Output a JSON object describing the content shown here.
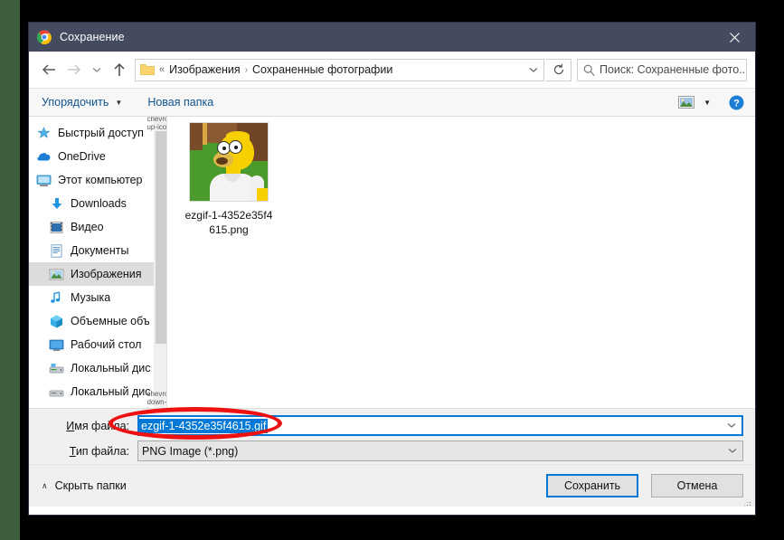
{
  "window": {
    "title": "Сохранение",
    "app_icon": "chrome-logo-icon",
    "close_label": "✕",
    "titlebar_color": "#454b5e"
  },
  "nav": {
    "back_icon": "arrow-left-icon",
    "forward_icon": "arrow-right-icon",
    "recent_icon": "chevron-down-icon",
    "up_icon": "arrow-up-icon",
    "refresh_icon": "refresh-icon",
    "address": {
      "folder_icon": "folder-icon",
      "overflow": "«",
      "separator": "›",
      "segments": [
        "Изображения",
        "Сохраненные фотографии"
      ],
      "dropdown_icon": "chevron-down-icon"
    },
    "search": {
      "icon": "search-icon",
      "placeholder": "Поиск: Сохраненные фото..."
    }
  },
  "toolbar": {
    "organize_label": "Упорядочить",
    "organize_caret": "▼",
    "new_folder_label": "Новая папка",
    "view_icon": "picture-view-icon",
    "view_caret": "▼",
    "help_icon": "help-circle-icon"
  },
  "sidebar": {
    "items": [
      {
        "label": "Быстрый доступ",
        "icon": "pin-star-icon",
        "indent": false,
        "selected": false
      },
      {
        "label": "OneDrive",
        "icon": "cloud-icon",
        "indent": false,
        "selected": false
      },
      {
        "label": "Этот компьютер",
        "icon": "monitor-icon",
        "indent": false,
        "selected": false
      },
      {
        "label": "Downloads",
        "icon": "download-arrow-icon",
        "indent": true,
        "selected": false
      },
      {
        "label": "Видео",
        "icon": "video-film-icon",
        "indent": true,
        "selected": false
      },
      {
        "label": "Документы",
        "icon": "documents-icon",
        "indent": true,
        "selected": false
      },
      {
        "label": "Изображения",
        "icon": "pictures-icon",
        "indent": true,
        "selected": true
      },
      {
        "label": "Музыка",
        "icon": "music-note-icon",
        "indent": true,
        "selected": false
      },
      {
        "label": "Объемные объ",
        "icon": "3d-objects-icon",
        "indent": true,
        "selected": false
      },
      {
        "label": "Рабочий стол",
        "icon": "desktop-icon",
        "indent": true,
        "selected": false
      },
      {
        "label": "Локальный дис",
        "icon": "local-disk-icon",
        "indent": true,
        "selected": false
      },
      {
        "label": "Локальный дис",
        "icon": "local-disk-icon",
        "indent": true,
        "selected": false
      }
    ],
    "scroll_up_icon": "chevron-up-icon",
    "scroll_down_icon": "chevron-down-icon"
  },
  "content": {
    "files": [
      {
        "name": "ezgif-1-4352e35f4615.png",
        "thumbnail": "homer-simpson-thumbnail"
      }
    ]
  },
  "form": {
    "filename_label": "Имя файла:",
    "filename_label_mnemonic": "И",
    "filename_value": "ezgif-1-4352e35f4615.gif",
    "filename_selected": true,
    "filetype_label": "Тип файла:",
    "filetype_label_mnemonic": "Т",
    "filetype_value": "PNG Image (*.png)",
    "dropdown_icon": "chevron-down-icon"
  },
  "footer": {
    "hide_folders_label": "Скрыть папки",
    "hide_folders_caret": "∧",
    "save_label": "Сохранить",
    "cancel_label": "Отмена",
    "resize_grip_icon": "resize-grip-icon"
  },
  "annotation": {
    "type": "red-oval-highlight",
    "color": "#ee1111",
    "target": "filetype-combobox"
  }
}
